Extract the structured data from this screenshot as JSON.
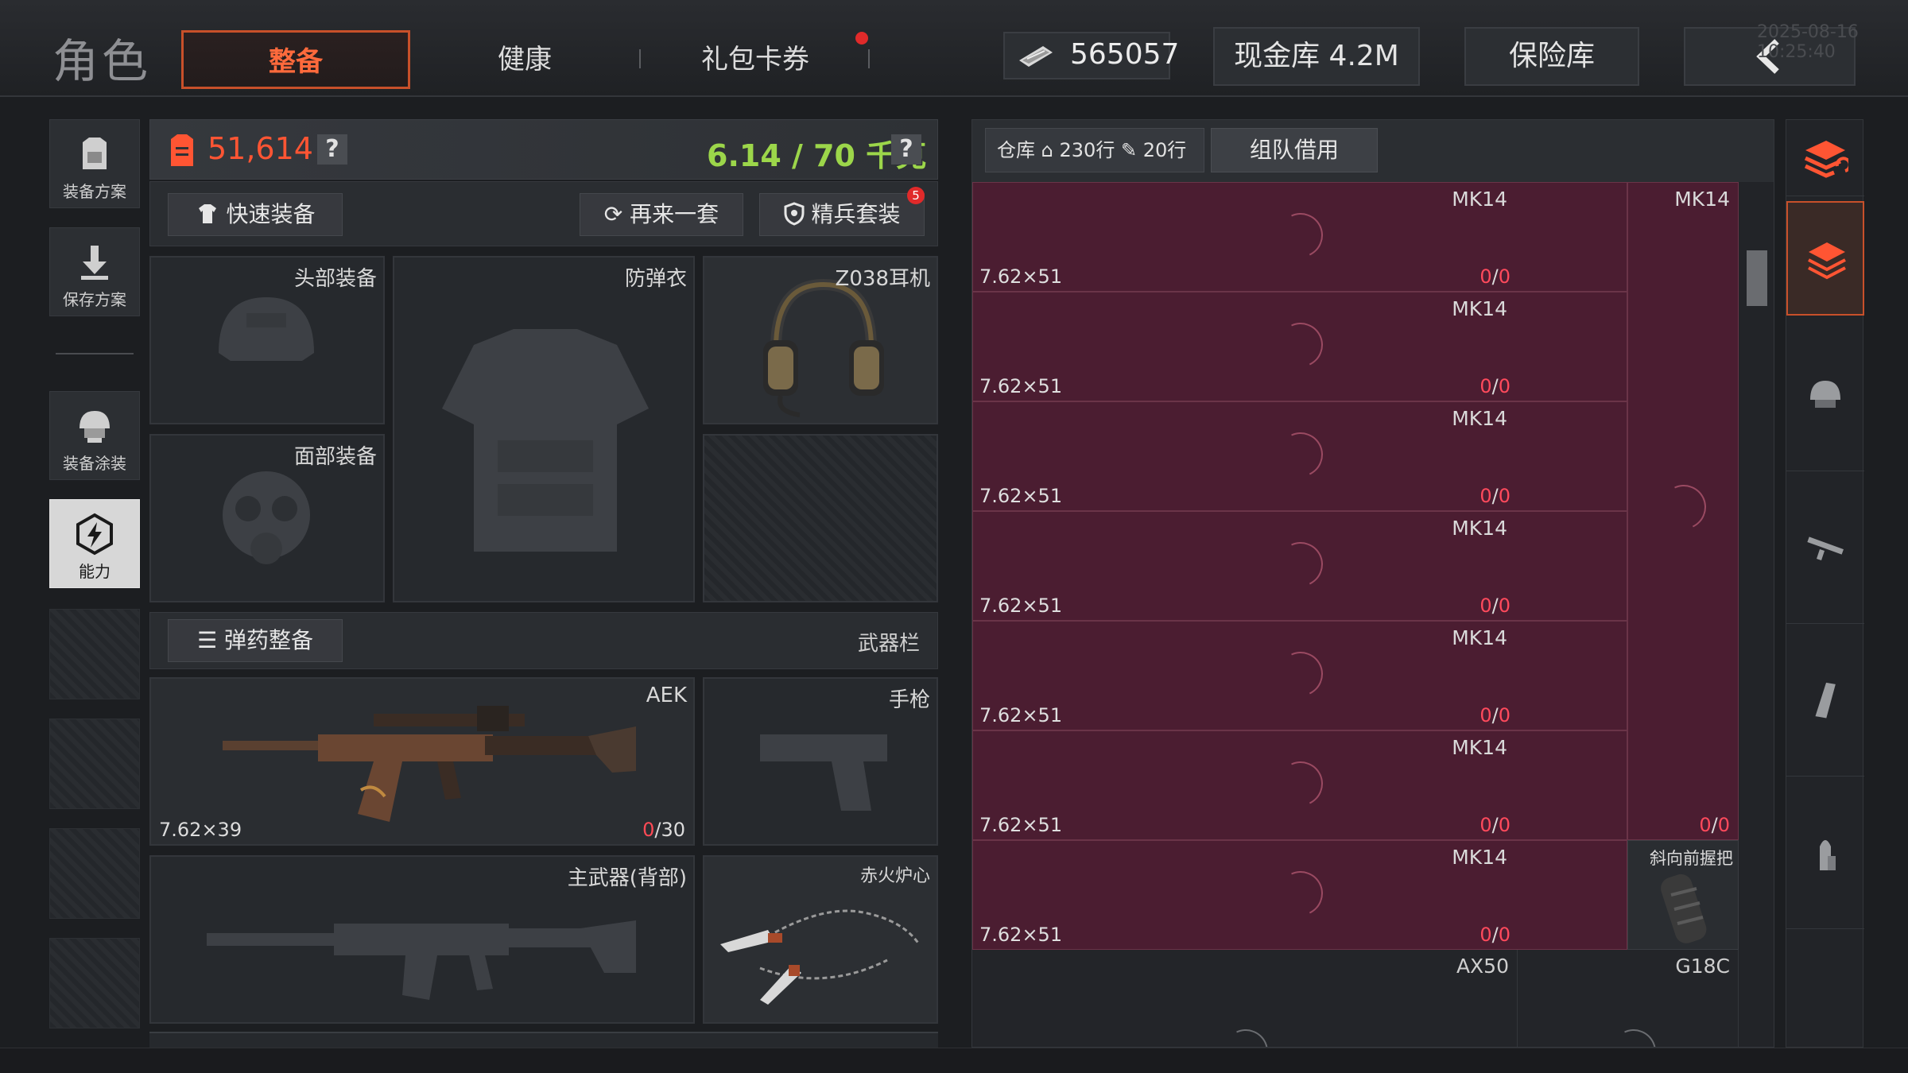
{
  "header": {
    "title": "角色",
    "tabs": [
      {
        "label": "整备",
        "active": true
      },
      {
        "label": "健康",
        "active": false
      },
      {
        "label": "礼包卡券",
        "active": false,
        "notification": true
      }
    ],
    "money": "565057",
    "vault_label": "现金库 4.2M",
    "safe_label": "保险库",
    "back_icon": "chevron-left-icon",
    "timestamp": "2025-08-16 10:25:40"
  },
  "sidebar": {
    "items": [
      {
        "label": "装备方案",
        "icon": "armor-loadout-icon"
      },
      {
        "label": "保存方案",
        "icon": "download-icon"
      },
      {
        "label": "装备涂装",
        "icon": "helmet-skin-icon"
      },
      {
        "label": "能力",
        "icon": "ability-icon",
        "selected": true
      }
    ]
  },
  "loadout": {
    "value": "51,614",
    "weight": "6.14 / 70 千克",
    "help": "?",
    "actions": {
      "quick_equip": "快速装备",
      "again_set": "再来一套",
      "elite_set": "精兵套装",
      "elite_badge": "5"
    },
    "slots": {
      "head": "头部装备",
      "face": "面部装备",
      "vest": "防弹衣",
      "headset": "Z038耳机"
    },
    "ammo_button": "弹药整备",
    "weapon_column": "武器栏",
    "weapons": {
      "primary": {
        "name": "AEK",
        "caliber": "7.62×39",
        "loaded": "0",
        "capacity": "/30"
      },
      "pistol": "手枪",
      "primary_back": "主武器(背部)",
      "melee": "赤火炉心"
    }
  },
  "inventory": {
    "storage_label": "仓库",
    "storage_rows": "230行",
    "ticket_rows": "20行",
    "team_borrow": "组队借用",
    "items": [
      {
        "name": "MK14",
        "caliber": "7.62×51",
        "loaded": "0",
        "capacity": "0"
      },
      {
        "name": "MK14",
        "caliber": "7.62×51",
        "loaded": "0",
        "capacity": "0"
      },
      {
        "name": "MK14",
        "caliber": "7.62×51",
        "loaded": "0",
        "capacity": "0"
      },
      {
        "name": "MK14",
        "caliber": "7.62×51",
        "loaded": "0",
        "capacity": "0"
      },
      {
        "name": "MK14",
        "caliber": "7.62×51",
        "loaded": "0",
        "capacity": "0"
      },
      {
        "name": "MK14",
        "caliber": "7.62×51",
        "loaded": "0",
        "capacity": "0"
      },
      {
        "name": "MK14",
        "caliber": "7.62×51",
        "loaded": "0",
        "capacity": "0"
      }
    ],
    "side_item": {
      "name": "MK14",
      "loaded": "0",
      "capacity": "0"
    },
    "grip_item": "斜向前握把",
    "bottom_items": [
      "AX50",
      "G18C"
    ]
  },
  "colors": {
    "accent": "#ff5533",
    "weight_ok": "#9cd64a",
    "item_bg": "#5c1a34",
    "alert": "#e02a2a"
  }
}
